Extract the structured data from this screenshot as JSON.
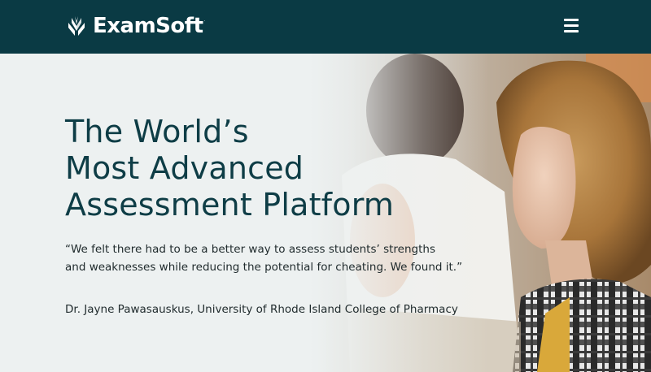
{
  "header": {
    "logo_text": "ExamSoft",
    "logo_trademark": "·",
    "menu_icon": "hamburger-menu-icon",
    "background_color": "#0a3a44"
  },
  "hero": {
    "headline_lines": [
      "The World’s",
      "Most Advanced",
      "Assessment Platform"
    ],
    "quote_lines": [
      "“We felt there had to be a better way to assess students’ strengths",
      "and weaknesses while reducing the potential for cheating. We found it.”"
    ],
    "attribution": "Dr. Jayne Pawasauskus, University of Rhode Island College of Pharmacy",
    "headline_color": "#0e3d46",
    "background_color": "#edf1f1"
  }
}
